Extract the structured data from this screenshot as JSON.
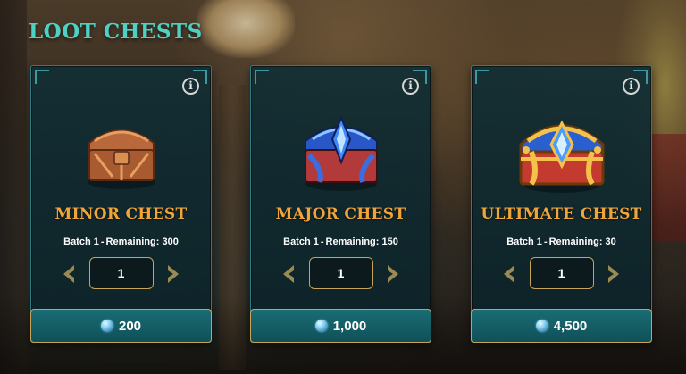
{
  "page": {
    "title": "LOOT CHESTS",
    "accent_color": "#4fd0c5",
    "gold_color": "#f0a53a"
  },
  "chests": [
    {
      "name": "MINOR CHEST",
      "batch_label": "Batch 1",
      "remaining_label": "Remaining: 300",
      "quantity": "1",
      "price": "200",
      "icon": "minor-chest-icon"
    },
    {
      "name": "MAJOR CHEST",
      "batch_label": "Batch 1",
      "remaining_label": "Remaining: 150",
      "quantity": "1",
      "price": "1,000",
      "icon": "major-chest-icon"
    },
    {
      "name": "ULTIMATE CHEST",
      "batch_label": "Batch 1",
      "remaining_label": "Remaining: 30",
      "quantity": "1",
      "price": "4,500",
      "icon": "ultimate-chest-icon"
    }
  ],
  "icons": {
    "info": "info-icon",
    "decrease": "chevron-left-icon",
    "increase": "chevron-right-icon",
    "currency": "gem-currency-icon"
  }
}
